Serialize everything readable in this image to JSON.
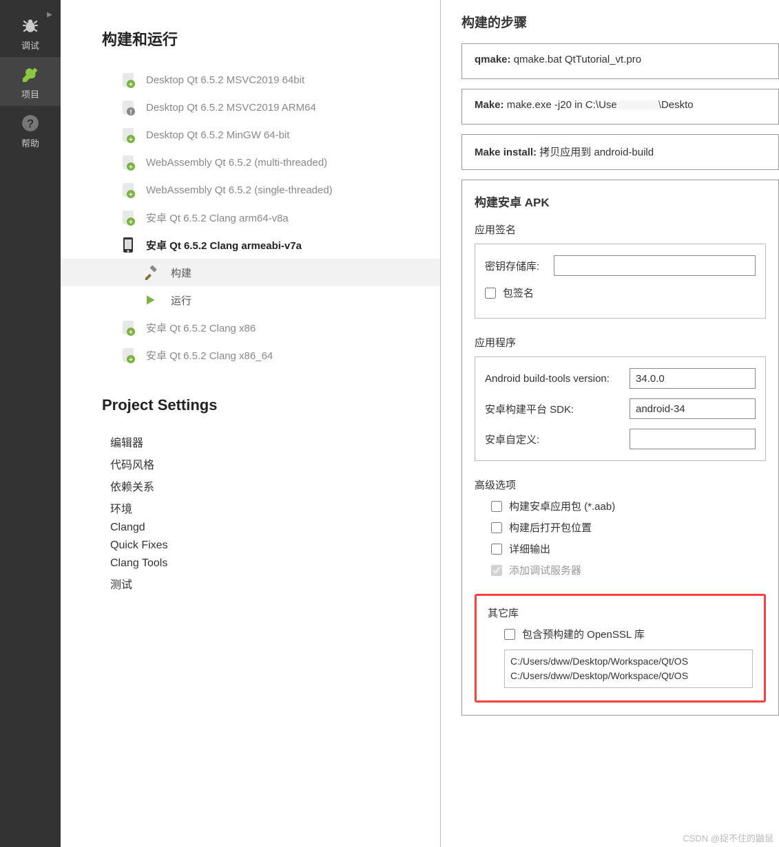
{
  "sidebar": {
    "debug_label": "调试",
    "project_label": "项目",
    "help_label": "帮助"
  },
  "build_run": {
    "title": "构建和运行",
    "kits": [
      "Desktop Qt 6.5.2 MSVC2019 64bit",
      "Desktop Qt 6.5.2 MSVC2019 ARM64",
      "Desktop Qt 6.5.2 MinGW 64-bit",
      "WebAssembly Qt 6.5.2 (multi-threaded)",
      "WebAssembly Qt 6.5.2 (single-threaded)",
      "安卓 Qt 6.5.2 Clang arm64-v8a",
      "安卓 Qt 6.5.2 Clang armeabi-v7a",
      "安卓 Qt 6.5.2 Clang x86",
      "安卓 Qt 6.5.2 Clang x86_64"
    ],
    "sub_build": "构建",
    "sub_run": "运行"
  },
  "project_settings": {
    "title": "Project Settings",
    "items": [
      "编辑器",
      "代码风格",
      "依赖关系",
      "环境",
      "Clangd",
      "Quick Fixes",
      "Clang Tools",
      "测试"
    ]
  },
  "steps": {
    "title": "构建的步骤",
    "qmake_label": "qmake:",
    "qmake_value": "qmake.bat QtTutorial_vt.pro",
    "make_label": "Make:",
    "make_value_before": "make.exe -j20 in C:\\Use",
    "make_value_after": "\\Deskto",
    "makeinstall_label": "Make install:",
    "makeinstall_value": "拷贝应用到 android-build"
  },
  "apk": {
    "title": "构建安卓 APK",
    "signing": {
      "label": "应用签名",
      "keystore_label": "密钥存储库:",
      "sign_package": "包签名"
    },
    "app": {
      "label": "应用程序",
      "buildtools_label": "Android build-tools version:",
      "buildtools_value": "34.0.0",
      "sdk_label": "安卓构建平台 SDK:",
      "sdk_value": "android-34",
      "custom_label": "安卓自定义:"
    },
    "advanced": {
      "label": "高级选项",
      "aab": "构建安卓应用包  (*.aab)",
      "open_after": "构建后打开包位置",
      "verbose": "详细输出",
      "debug_server": "添加调试服务器"
    },
    "other_libs": {
      "label": "其它库",
      "include_openssl": "包含预构建的 OpenSSL 库",
      "paths": [
        "C:/Users/dww/Desktop/Workspace/Qt/OS",
        "C:/Users/dww/Desktop/Workspace/Qt/OS"
      ]
    }
  },
  "watermark": "CSDN @捉不住的鼬鼠"
}
